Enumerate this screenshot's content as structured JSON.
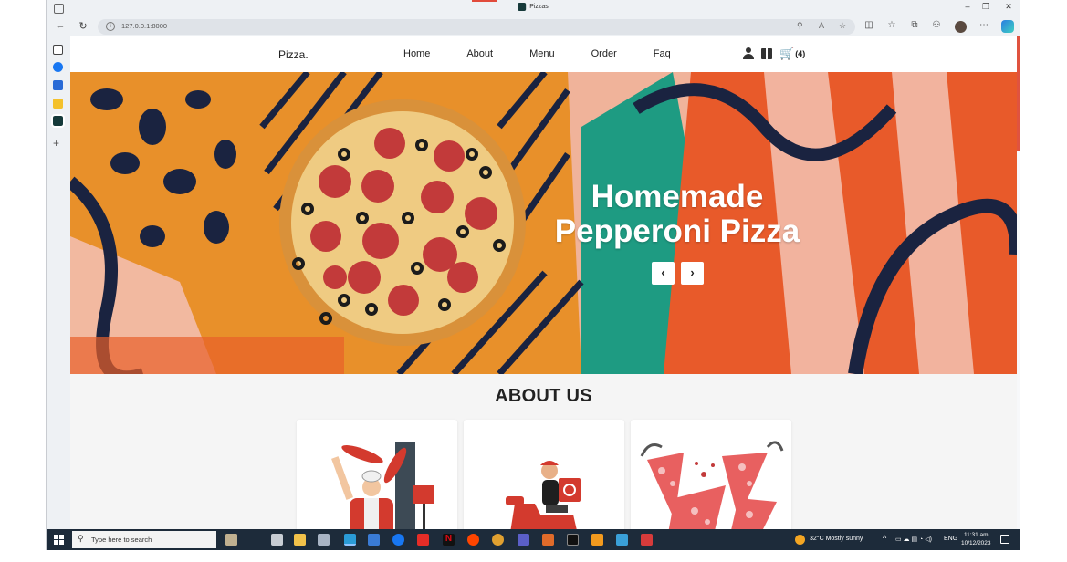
{
  "browser": {
    "tab_title": "Pizzas",
    "url": "127.0.0.1:8000"
  },
  "site": {
    "brand": "Pizza.",
    "menu": [
      "Home",
      "About",
      "Menu",
      "Order",
      "Faq"
    ],
    "cart_count": "(4)"
  },
  "hero": {
    "title_line1": "Homemade",
    "title_line2": "Pepperoni Pizza",
    "prev_glyph": "‹",
    "next_glyph": "›"
  },
  "about": {
    "title": "ABOUT US",
    "cards": [
      "chef-illustration",
      "delivery-rider-illustration",
      "pizza-slices-illustration"
    ]
  },
  "taskbar": {
    "search_placeholder": "Type here to search",
    "weather": "32°C  Mostly sunny",
    "language": "ENG",
    "time": "11:31 am",
    "date": "10/12/2023"
  },
  "colors": {
    "brand_red": "#e14b3b",
    "hero_orange": "#e8902a",
    "navy": "#1a2340",
    "teal": "#1e9b82"
  }
}
